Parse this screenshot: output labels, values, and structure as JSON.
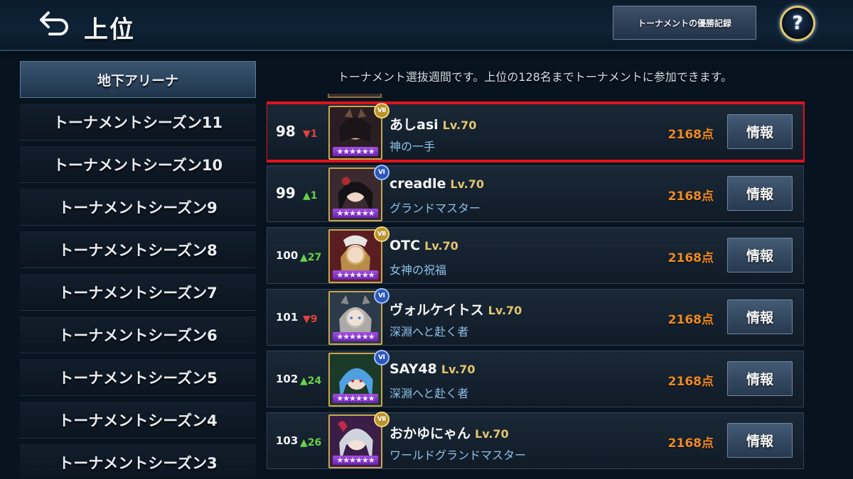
{
  "header": {
    "title": "上位",
    "history_button": "トーナメントの優勝記録",
    "help_label": "?"
  },
  "sidebar": {
    "items": [
      {
        "label": "地下アリーナ",
        "active": true
      },
      {
        "label": "トーナメントシーズン11"
      },
      {
        "label": "トーナメントシーズン10"
      },
      {
        "label": "トーナメントシーズン9"
      },
      {
        "label": "トーナメントシーズン8"
      },
      {
        "label": "トーナメントシーズン7"
      },
      {
        "label": "トーナメントシーズン6"
      },
      {
        "label": "トーナメントシーズン5"
      },
      {
        "label": "トーナメントシーズン4"
      },
      {
        "label": "トーナメントシーズン3"
      }
    ]
  },
  "notice": "トーナメント選抜週間です。上位の128名までトーナメントに参加できます。",
  "rankings": [
    {
      "rank": "98",
      "change": "▼1",
      "direction": "down",
      "badge": "Ⅶ",
      "name": "あしasi",
      "level": "Lv.70",
      "title": "神の一手",
      "points": "2168点",
      "info": "情報",
      "stars": "★★★★★★",
      "highlighted": true
    },
    {
      "rank": "99",
      "change": "▲1",
      "direction": "up",
      "badge": "Ⅵ",
      "name": "creadle",
      "level": "Lv.70",
      "title": "グランドマスター",
      "points": "2168点",
      "info": "情報",
      "stars": "★★★★★★"
    },
    {
      "rank": "100",
      "change": "▲27",
      "direction": "up",
      "badge": "Ⅶ",
      "name": "OTC",
      "level": "Lv.70",
      "title": "女神の祝福",
      "points": "2168点",
      "info": "情報",
      "stars": "★★★★★★"
    },
    {
      "rank": "101",
      "change": "▼9",
      "direction": "down",
      "badge": "Ⅵ",
      "name": "ヴォルケイトス",
      "level": "Lv.70",
      "title": "深淵へと赴く者",
      "points": "2168点",
      "info": "情報",
      "stars": "★★★★★★"
    },
    {
      "rank": "102",
      "change": "▲24",
      "direction": "up",
      "badge": "Ⅵ",
      "name": "SAY48",
      "level": "Lv.70",
      "title": "深淵へと赴く者",
      "points": "2168点",
      "info": "情報",
      "stars": "★★★★★★"
    },
    {
      "rank": "103",
      "change": "▲26",
      "direction": "up",
      "badge": "Ⅶ",
      "name": "おかゆにゃん",
      "level": "Lv.70",
      "title": "ワールドグランドマスター",
      "points": "2168点",
      "info": "情報",
      "stars": "★★★★★★"
    }
  ],
  "colors": {
    "highlight": "#e0121c",
    "points": "#f08a23",
    "level": "#e2c56e",
    "title_text": "#8ec2e8",
    "up": "#66d24a",
    "down": "#e0433b"
  }
}
